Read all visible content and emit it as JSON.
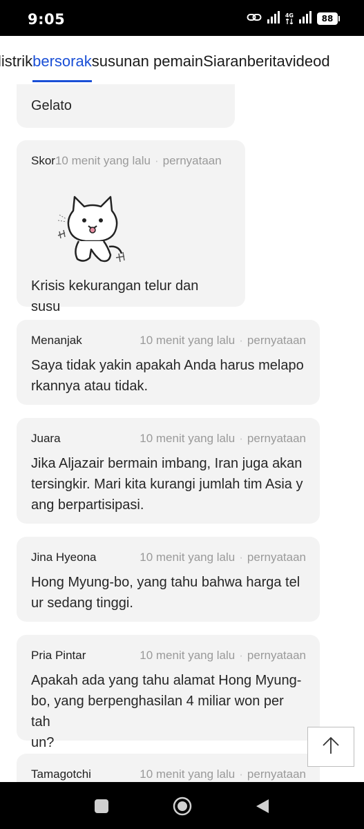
{
  "status_bar": {
    "time": "9:05",
    "network": "4G",
    "battery": "88",
    "icons": [
      "link-icon",
      "signal-icon",
      "signal-4g-icon",
      "battery-icon"
    ]
  },
  "tabs": [
    {
      "label": "listrik",
      "active": false
    },
    {
      "label": "bersorak",
      "active": true
    },
    {
      "label": "susunan pemain",
      "active": false
    },
    {
      "label": "Siaran",
      "active": false
    },
    {
      "label": "berita",
      "active": false
    },
    {
      "label": "video",
      "active": false
    },
    {
      "label": "d",
      "active": false
    }
  ],
  "comments": [
    {
      "author": "",
      "time": "",
      "separator": "",
      "action": "",
      "text": "Gelato"
    },
    {
      "author": "Skor",
      "time": "10 menit yang lalu",
      "separator": "·",
      "action": "pernyataan",
      "text": "Krisis kekurangan telur dan susu",
      "sticker": "cat-sticker"
    },
    {
      "author": "Menanjak",
      "time": "10 menit yang lalu",
      "separator": "·",
      "action": "pernyataan",
      "lines": [
        "Saya tidak yakin apakah Anda harus melapo",
        "rkannya atau tidak."
      ]
    },
    {
      "author": "Juara",
      "time": "10 menit yang lalu",
      "separator": "·",
      "action": "pernyataan",
      "lines": [
        "Jika Aljazair bermain imbang, Iran juga akan",
        "tersingkir. Mari kita kurangi jumlah tim Asia y",
        "ang berpartisipasi."
      ]
    },
    {
      "author": "Jina Hyeona",
      "time": "10 menit yang lalu",
      "separator": "·",
      "action": "pernyataan",
      "lines": [
        "Hong Myung-bo, yang tahu bahwa harga tel",
        "ur sedang tinggi."
      ]
    },
    {
      "author": "Pria Pintar",
      "time": "10 menit yang lalu",
      "separator": "·",
      "action": "pernyataan",
      "lines": [
        "Apakah ada yang tahu alamat Hong Myung-",
        "bo, yang berpenghasilan 4 miliar won per tah",
        "un?"
      ]
    },
    {
      "author": "Tamagotchi",
      "time": "10 menit yang lalu",
      "separator": "·",
      "action": "pernyataan",
      "text": ""
    }
  ],
  "scroll_top": {
    "icon": "arrow-up-icon"
  },
  "nav_bar": {
    "icons": [
      "recents-icon",
      "home-icon",
      "back-icon"
    ]
  },
  "colors": {
    "accent": "#1a4fd6",
    "card_bg": "#f3f3f3",
    "meta_text": "#9a9a9a"
  }
}
